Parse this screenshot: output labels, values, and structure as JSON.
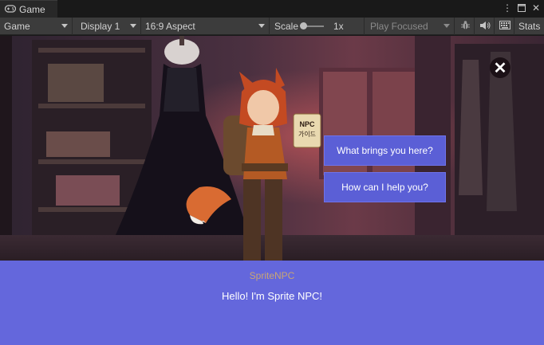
{
  "tab": {
    "label": "Game",
    "icon": "gamepad-icon"
  },
  "window_controls": [
    "more-vertical-icon",
    "maximize-icon",
    "close-icon"
  ],
  "toolbar": {
    "mode": "Game",
    "display": "Display 1",
    "aspect": "16:9 Aspect",
    "scale_label": "Scale",
    "scale_value": "1x",
    "play_mode": "Play Focused",
    "stats": "Stats",
    "icons": [
      "bug-icon",
      "speaker-icon",
      "keyboard-icon"
    ]
  },
  "game": {
    "sign_text_1": "NPC",
    "sign_text_2": "가이드",
    "choices": [
      "What brings you here?",
      "How can I help you?"
    ],
    "dialog": {
      "speaker": "SpriteNPC",
      "text": "Hello! I'm Sprite NPC!"
    }
  },
  "colors": {
    "panel": "#6467dc",
    "button": "#5b5fd6",
    "speaker": "#c9a574"
  }
}
